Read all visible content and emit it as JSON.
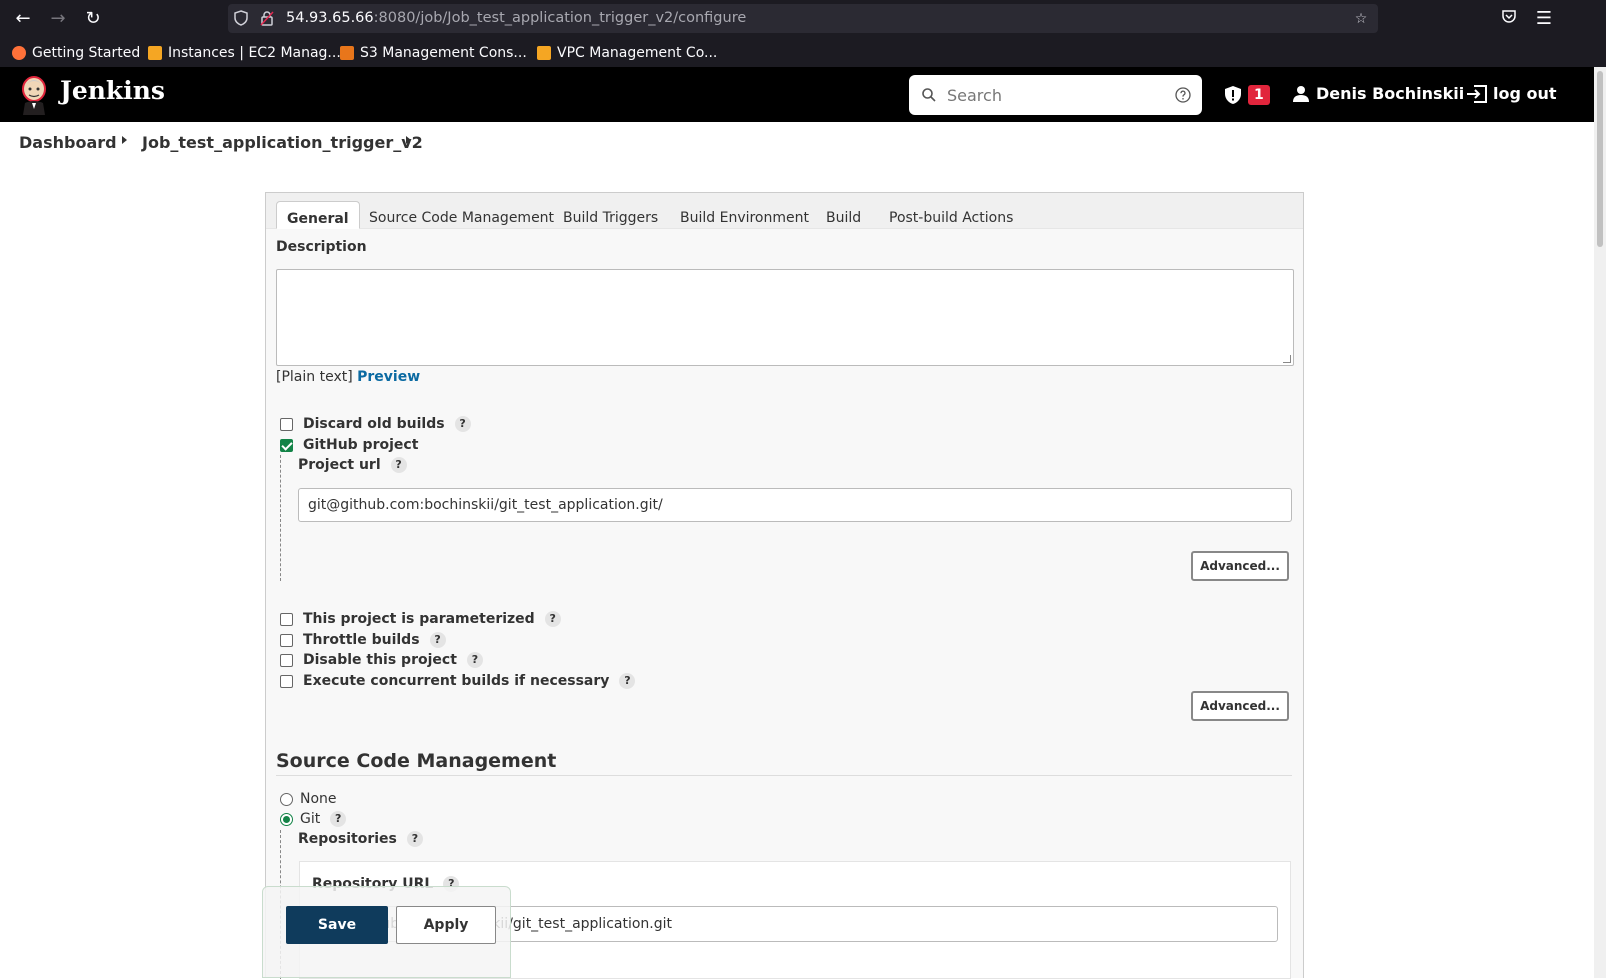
{
  "browser": {
    "url_host": "54.93.65.66",
    "url_rest": ":8080/job/Job_test_application_trigger_v2/configure",
    "bookmarks": [
      {
        "label": "Getting Started",
        "icon": "firefox-icon",
        "color": "#ff7139"
      },
      {
        "label": "Instances | EC2 Manag...",
        "icon": "aws-box-icon",
        "color": "#f5a623"
      },
      {
        "label": "S3 Management Cons...",
        "icon": "aws-box-icon",
        "color": "#e8761b"
      },
      {
        "label": "VPC Management Co...",
        "icon": "aws-box-icon",
        "color": "#f5a623"
      }
    ]
  },
  "header": {
    "app_title": "Jenkins",
    "search_placeholder": "Search",
    "security_count": "1",
    "user_name": "Denis Bochinskii",
    "logout_label": "log out",
    "badge_color": "#e1253c"
  },
  "breadcrumb": {
    "items": [
      "Dashboard",
      "Job_test_application_trigger_v2"
    ]
  },
  "tabs": [
    {
      "label": "General",
      "active": true
    },
    {
      "label": "Source Code Management",
      "active": false
    },
    {
      "label": "Build Triggers",
      "active": false
    },
    {
      "label": "Build Environment",
      "active": false
    },
    {
      "label": "Build",
      "active": false
    },
    {
      "label": "Post-build Actions",
      "active": false
    }
  ],
  "general": {
    "description_label": "Description",
    "description_value": "",
    "plain_text": "[Plain text]",
    "preview_label": "Preview",
    "discard_old_builds": {
      "label": "Discard old builds",
      "checked": false
    },
    "github_project": {
      "label": "GitHub project",
      "checked": true
    },
    "project_url_label": "Project url",
    "project_url_value": "git@github.com:bochinskii/git_test_application.git/",
    "advanced_label": "Advanced...",
    "options": [
      {
        "label": "This project is parameterized",
        "checked": false
      },
      {
        "label": "Throttle builds",
        "checked": false
      },
      {
        "label": "Disable this project",
        "checked": false
      },
      {
        "label": "Execute concurrent builds if necessary",
        "checked": false
      }
    ],
    "advanced_label_2": "Advanced..."
  },
  "scm": {
    "title": "Source Code Management",
    "none_label": "None",
    "git_label": "Git",
    "selected": "Git",
    "repositories_label": "Repositories",
    "repository_url_label": "Repository URL",
    "repository_url_value": "git@github.com:bochinskii/git_test_application.git"
  },
  "actions": {
    "save_label": "Save",
    "apply_label": "Apply"
  },
  "colors": {
    "accent_green": "#138347",
    "save_blue": "#0f3b5c",
    "link_blue": "#0b6aa2"
  }
}
